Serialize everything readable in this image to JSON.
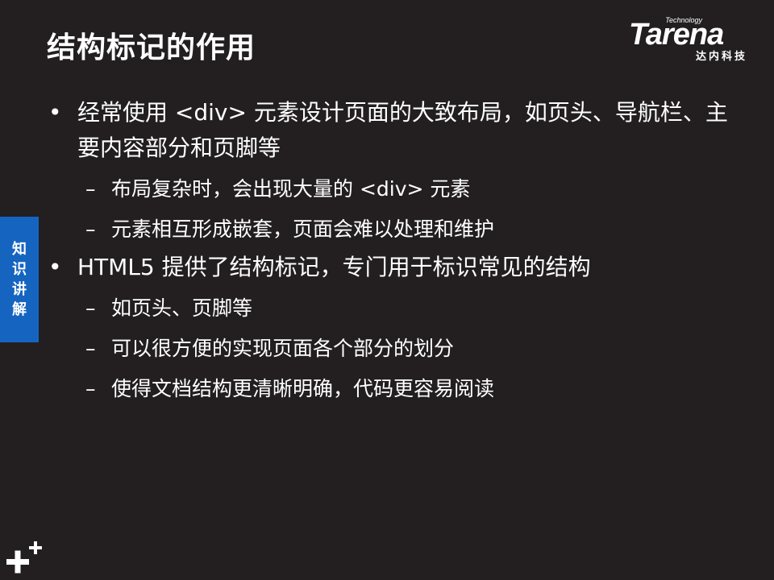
{
  "slide": {
    "title": "结构标记的作用",
    "logo": {
      "technology": "Technology",
      "name": "Tarena",
      "chinese": "达内科技"
    },
    "side_tab": [
      "知",
      "识",
      "讲",
      "解"
    ],
    "bullets": [
      {
        "text": "经常使用 <div> 元素设计页面的大致布局，如页头、导航栏、主要内容部分和页脚等",
        "sub": [
          "布局复杂时，会出现大量的 <div> 元素",
          "元素相互形成嵌套，页面会难以处理和维护"
        ]
      },
      {
        "text": "HTML5 提供了结构标记，专门用于标识常见的结构",
        "sub": [
          "如页头、页脚等",
          "可以很方便的实现页面各个部分的划分",
          "使得文档结构更清晰明确，代码更容易阅读"
        ]
      }
    ],
    "bullet_symbol": "•",
    "dash_symbol": "–",
    "colors": {
      "background": "#231f20",
      "text": "#ffffff",
      "side_tab": "#1565c0"
    },
    "icons": {
      "corner": "plus-plus-icon"
    }
  }
}
